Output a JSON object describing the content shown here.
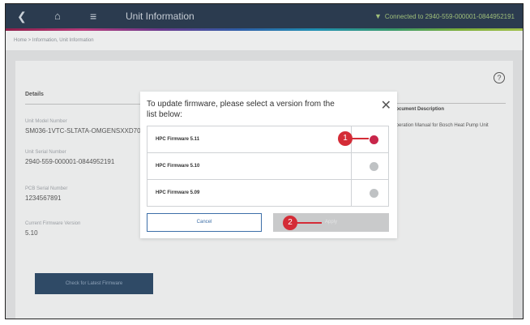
{
  "topbar": {
    "back_icon": "chevron-left-icon",
    "home_icon": "home-icon",
    "menu_icon": "hamburger-menu-icon",
    "title": "Unit Information",
    "connection_status": "Connected to 2940-559-000001-0844952191"
  },
  "breadcrumb": {
    "text": "Home  >  Information, Unit Information"
  },
  "details": {
    "heading": "Details",
    "unit_model_label": "Unit Model Number",
    "unit_model_value": "SM036-1VTC-SLTATA-OMGENSXXD70",
    "unit_serial_label": "Unit Serial Number",
    "unit_serial_value": "2940-559-000001-0844952191",
    "pcb_serial_label": "PCB Serial Number",
    "pcb_serial_value": "1234567891",
    "firmware_label": "Current Firmware Version",
    "firmware_value": "5.10",
    "check_button": "Check for Latest Firmware"
  },
  "documents": {
    "heading": "Document Description",
    "item": "Operation Manual for Bosch Heat Pump Unit"
  },
  "modal": {
    "title": "To update firmware, please select a version from the list below:",
    "close_icon": "close-icon",
    "options": [
      {
        "label": "HPC Firmware 5.11",
        "selected": true
      },
      {
        "label": "HPC Firmware 5.10",
        "selected": false
      },
      {
        "label": "HPC Firmware 5.09",
        "selected": false
      }
    ],
    "cancel_label": "Cancel",
    "apply_label": "Apply",
    "callout_1": "1",
    "callout_2": "2"
  },
  "colors": {
    "topbar": "#2b3b4f",
    "callout": "#d42c37",
    "selected_radio": "#c8264a",
    "cancel_border": "#3d6fa8"
  }
}
